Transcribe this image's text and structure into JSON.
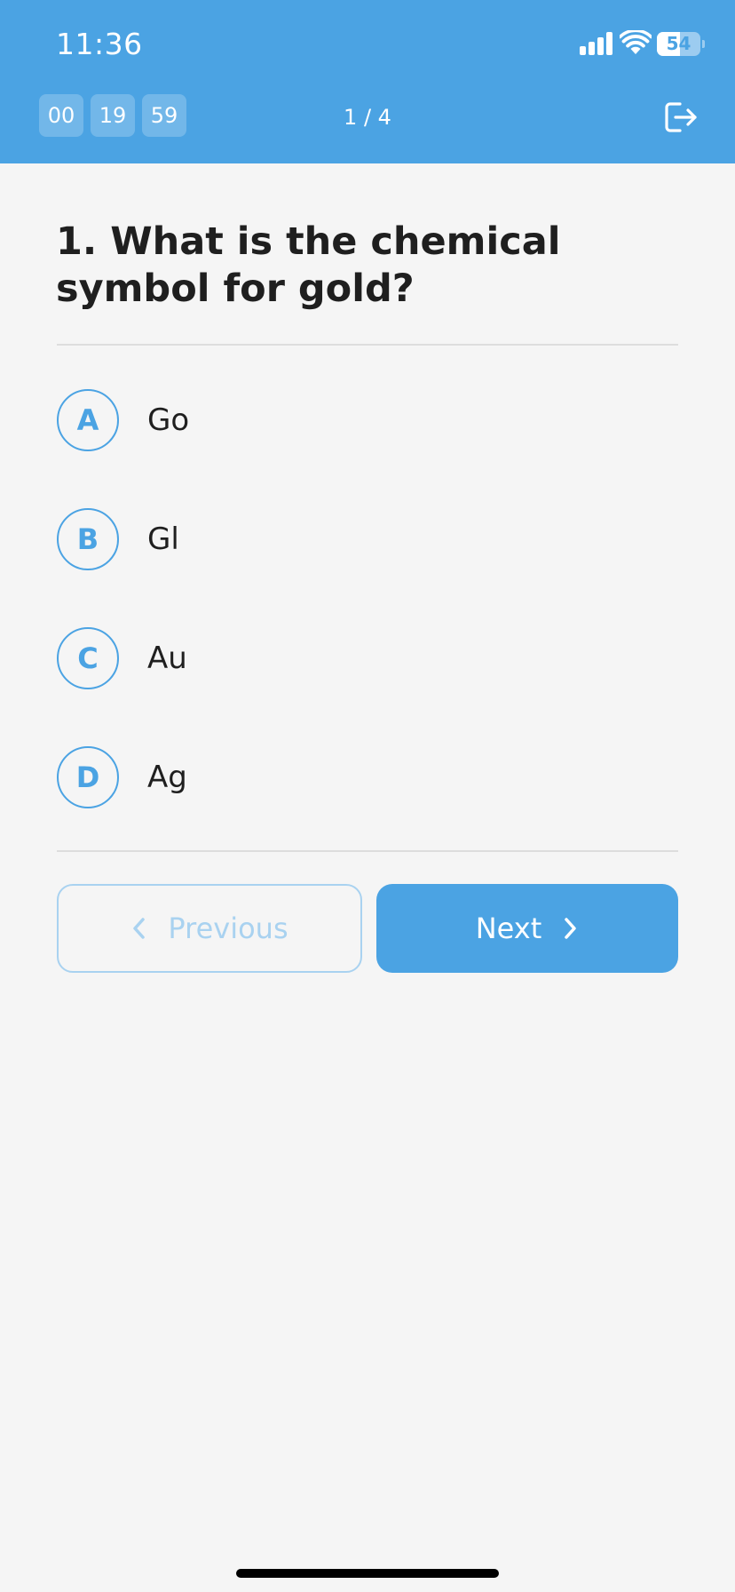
{
  "status_bar": {
    "time": "11:36",
    "battery": "54",
    "battery_level": 0.54
  },
  "header": {
    "timer": {
      "hours": "00",
      "minutes": "19",
      "seconds": "59"
    },
    "progress": "1 / 4",
    "exit_icon": "logout-icon"
  },
  "question": {
    "text": "1. What is the chemical symbol for gold?",
    "options": [
      {
        "letter": "A",
        "text": "Go"
      },
      {
        "letter": "B",
        "text": "Gl"
      },
      {
        "letter": "C",
        "text": "Au"
      },
      {
        "letter": "D",
        "text": "Ag"
      }
    ]
  },
  "navigation": {
    "previous_label": "Previous",
    "next_label": "Next",
    "previous_icon": "chevron-left-icon",
    "next_icon": "chevron-right-icon"
  },
  "colors": {
    "accent": "#4ba3e3",
    "disabled": "#a9d2f0",
    "background": "#f5f5f5",
    "text": "#1f1f1f"
  }
}
